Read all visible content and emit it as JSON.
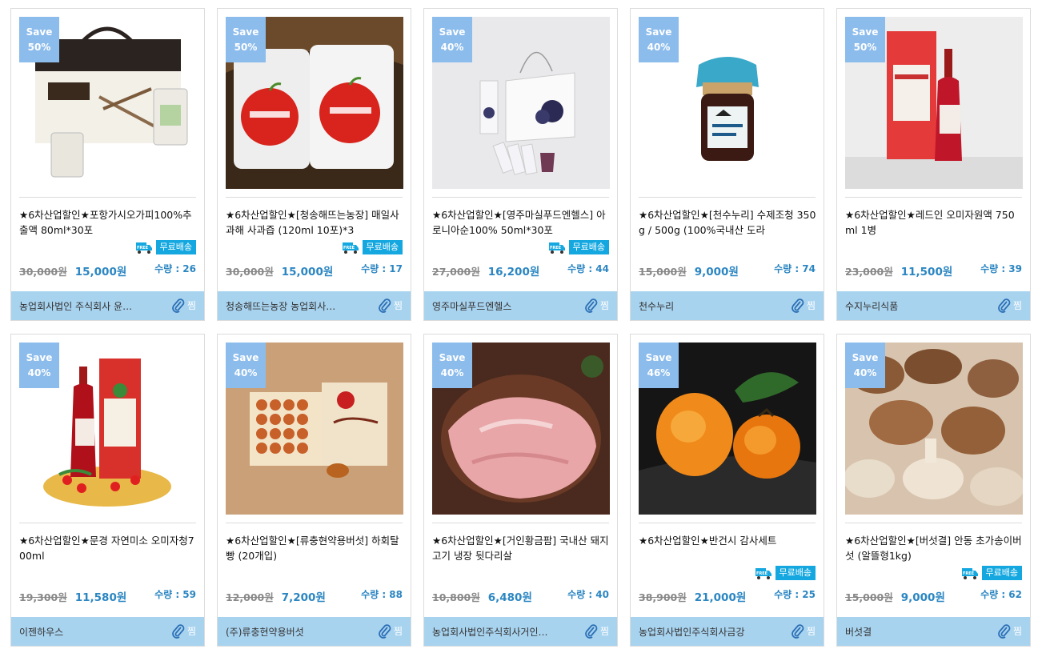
{
  "colors": {
    "save_badge": "#8cbcec",
    "free_badge": "#15a8e0",
    "footer": "#a8d3ef",
    "sale_price": "#2b86c2"
  },
  "labels": {
    "save": "Save",
    "free_shipping": "무료배송",
    "wishlist": "찜",
    "free_icon": "FREE"
  },
  "products": [
    {
      "discount": "50%",
      "title": "★6차산업할인★포항가시오가피100%추출액 80ml*30포",
      "free_shipping": true,
      "original_price": "30,000원",
      "sale_price": "15,000원",
      "quantity": "수량 : 26",
      "seller": "농업회사법인 주식회사 윤…",
      "image": "gift-box-acanthopanax"
    },
    {
      "discount": "50%",
      "title": "★6차산업할인★[청송해뜨는농장] 매일사과해 사과즙 (120ml 10포)*3",
      "free_shipping": true,
      "original_price": "30,000원",
      "sale_price": "15,000원",
      "quantity": "수량 : 17",
      "seller": "청송해뜨는농장 농업회사…",
      "image": "apple-juice-pouches"
    },
    {
      "discount": "40%",
      "title": "★6차산업할인★[영주마실푸드엔헬스] 아로니아순100% 50ml*30포",
      "free_shipping": true,
      "original_price": "27,000원",
      "sale_price": "16,200원",
      "quantity": "수량 : 44",
      "seller": "영주마실푸드엔헬스",
      "image": "aronia-gift-set"
    },
    {
      "discount": "40%",
      "title": "★6차산업할인★[천수누리] 수제조청 350g / 500g (100%국내산 도라",
      "free_shipping": false,
      "original_price": "15,000원",
      "sale_price": "9,000원",
      "quantity": "수량 : 74",
      "seller": "천수누리",
      "image": "syrup-jar"
    },
    {
      "discount": "50%",
      "title": "★6차산업할인★레드인 오미자원액 750ml 1병",
      "free_shipping": false,
      "original_price": "23,000원",
      "sale_price": "11,500원",
      "quantity": "수량 : 39",
      "seller": "수지누리식품",
      "image": "omija-bottle-box"
    },
    {
      "discount": "40%",
      "title": "★6차산업할인★문경 자연미소 오미자청700ml",
      "free_shipping": false,
      "original_price": "19,300원",
      "sale_price": "11,580원",
      "quantity": "수량 : 59",
      "seller": "이젠하우스",
      "image": "omija-syrup-board"
    },
    {
      "discount": "40%",
      "title": "★6차산업할인★[류충현약용버섯] 하회탈빵 (20개입)",
      "free_shipping": false,
      "original_price": "12,000원",
      "sale_price": "7,200원",
      "quantity": "수량 : 88",
      "seller": "(주)류충현약용버섯",
      "image": "hahoe-bread-box"
    },
    {
      "discount": "40%",
      "title": "★6차산업할인★[거인황금팜] 국내산 돼지고기 냉장 뒷다리살",
      "free_shipping": false,
      "original_price": "10,800원",
      "sale_price": "6,480원",
      "quantity": "수량 : 40",
      "seller": "농업회사법인주식회사거인…",
      "image": "raw-pork"
    },
    {
      "discount": "46%",
      "title": "★6차산업할인★반건시 감사세트",
      "free_shipping": true,
      "original_price": "38,900원",
      "sale_price": "21,000원",
      "quantity": "수량 : 25",
      "seller": "농업회사법인주식회사금강",
      "image": "dried-persimmon"
    },
    {
      "discount": "40%",
      "title": "★6차산업할인★[버섯결] 안동 초가송이버섯 (알뜰형1kg)",
      "free_shipping": true,
      "original_price": "15,000원",
      "sale_price": "9,000원",
      "quantity": "수량 : 62",
      "seller": "버섯결",
      "image": "shiitake-mushrooms"
    }
  ]
}
